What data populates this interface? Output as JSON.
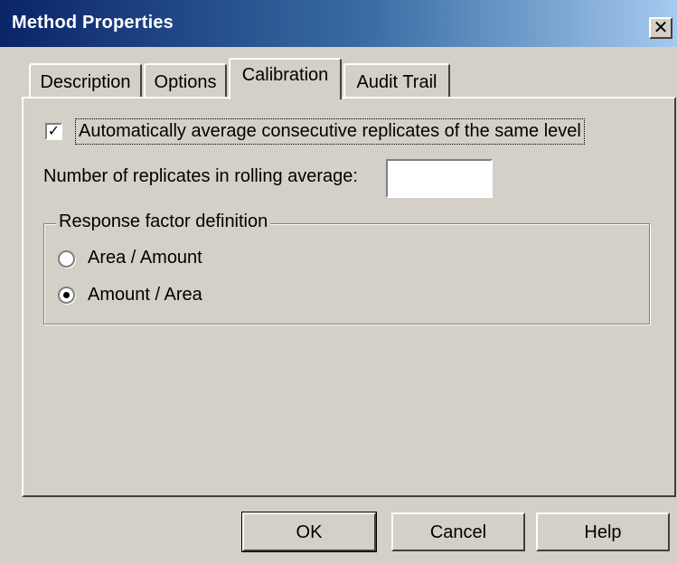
{
  "window": {
    "title": "Method Properties",
    "close_glyph": "✕"
  },
  "tabs": [
    {
      "label": "Description",
      "active": false
    },
    {
      "label": "Options",
      "active": false
    },
    {
      "label": "Calibration",
      "active": true
    },
    {
      "label": "Audit Trail",
      "active": false
    }
  ],
  "calibration": {
    "auto_average": {
      "label": "Automatically average consecutive replicates of the same level",
      "checked": true,
      "check_glyph": "✓"
    },
    "replicates": {
      "label": "Number of replicates in rolling average:",
      "value": ""
    },
    "response_factor": {
      "group_label": "Response factor definition",
      "options": [
        {
          "label": "Area / Amount",
          "selected": false
        },
        {
          "label": "Amount / Area",
          "selected": true
        }
      ]
    }
  },
  "buttons": {
    "ok": "OK",
    "cancel": "Cancel",
    "help": "Help"
  },
  "colors": {
    "dialog_face": "#d4d0c8",
    "title_gradient_start": "#0a246a",
    "title_gradient_end": "#a6caf0"
  }
}
